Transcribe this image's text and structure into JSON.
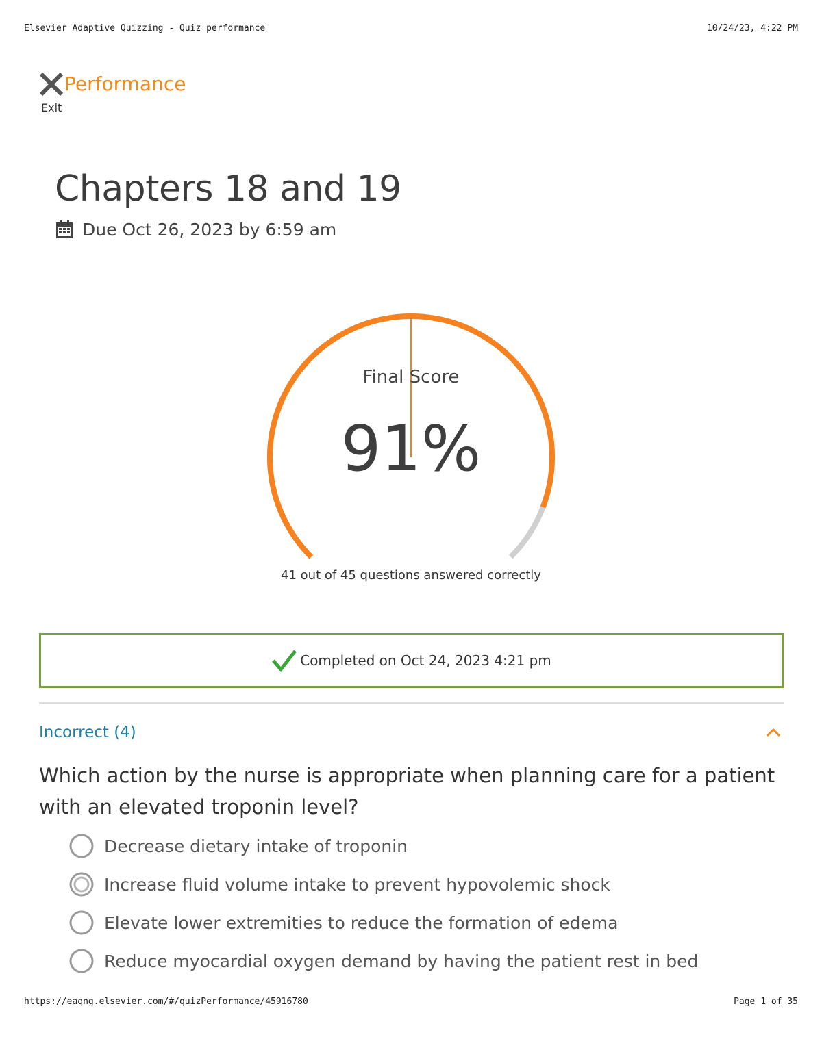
{
  "print_header": {
    "left": "Elsevier Adaptive Quizzing - Quiz performance",
    "right": "10/24/23, 4:22 PM"
  },
  "print_footer": {
    "left": "https://eaqng.elsevier.com/#/quizPerformance/45916780",
    "right": "Page 1 of 35"
  },
  "header": {
    "title": "Performance",
    "exit_label": "Exit",
    "exit_icon": "close-x-icon"
  },
  "quiz": {
    "title": "Chapters 18 and 19",
    "due": "Due Oct 26, 2023 by 6:59 am",
    "due_icon": "calendar-icon"
  },
  "score": {
    "label": "Final Score",
    "value_text": "91%",
    "fraction": 0.91,
    "summary": "41 out of 45 questions answered correctly",
    "correct": 41,
    "total": 45
  },
  "completed": {
    "text": "Completed on Oct 24, 2023 4:21 pm",
    "icon": "checkmark-icon"
  },
  "section": {
    "title": "Incorrect (4)",
    "expanded": true
  },
  "question": {
    "text": "Which action by the nurse is appropriate when planning care for a patient with an elevated troponin level?",
    "options": [
      {
        "text": "Decrease dietary intake of troponin",
        "selected": false
      },
      {
        "text": "Increase fluid volume intake to prevent hypovolemic shock",
        "selected": true
      },
      {
        "text": "Elevate lower extremities to reduce the formation of edema",
        "selected": false
      },
      {
        "text": "Reduce myocardial oxygen demand by having the patient rest in bed",
        "selected": false
      }
    ]
  },
  "colors": {
    "accent": "#f5821f",
    "track": "#d0d0d0",
    "completed_border": "#78a040",
    "check": "#3aa63a",
    "section_title": "#1f7fa3"
  }
}
